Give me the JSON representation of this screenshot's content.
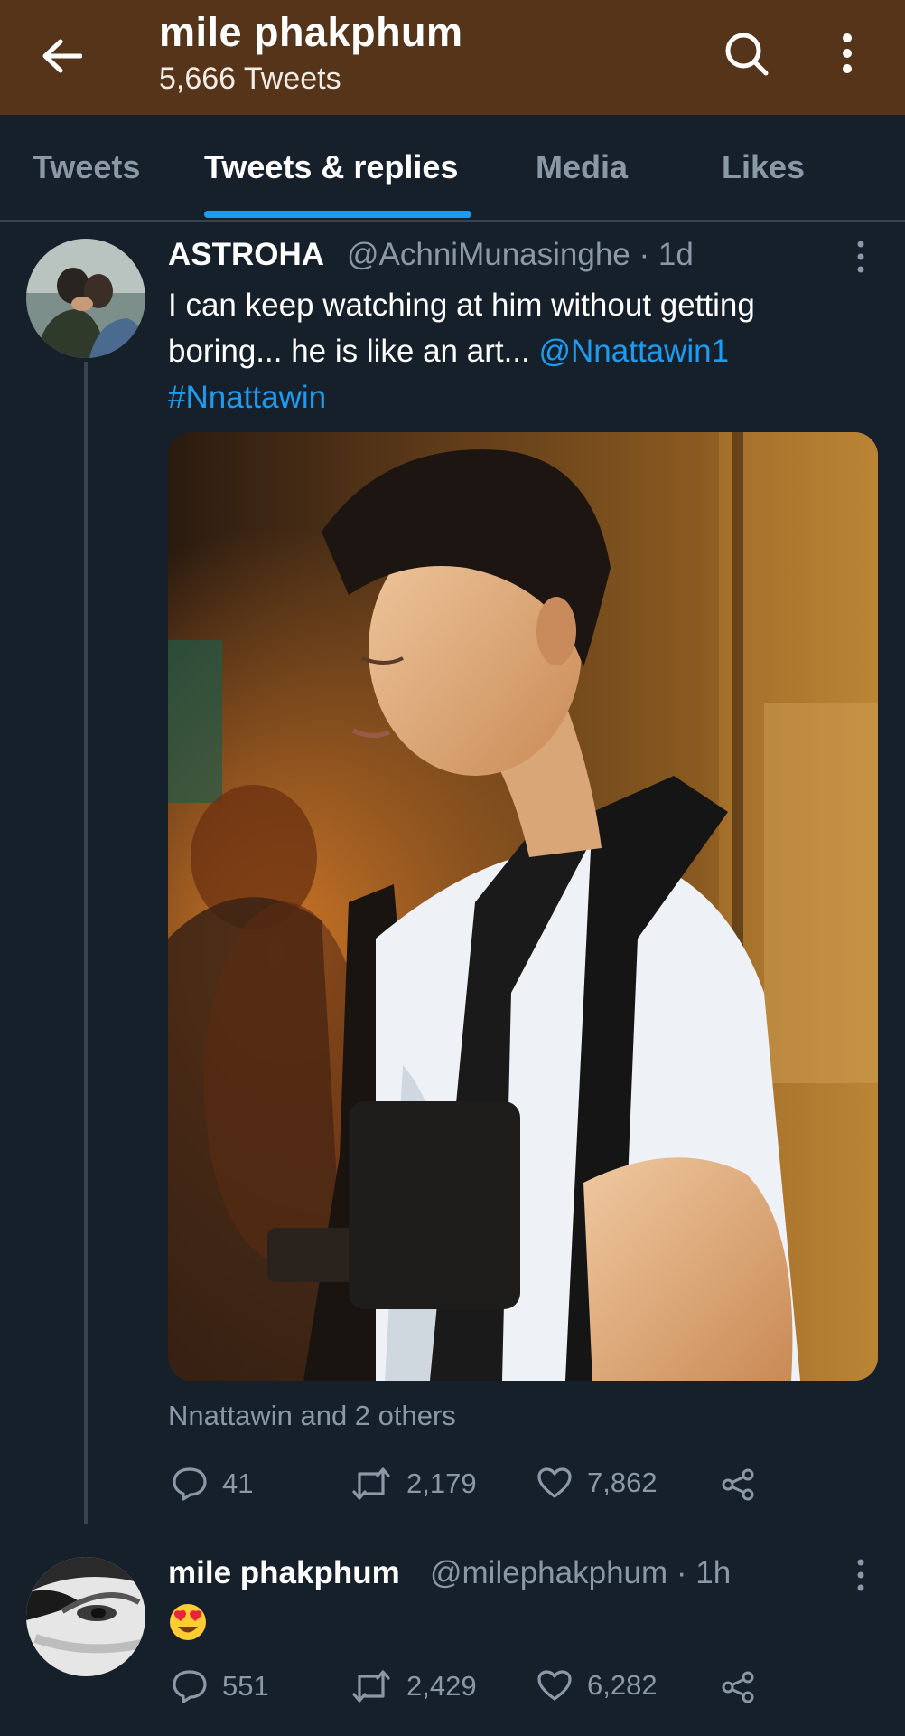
{
  "header": {
    "title": "mile phakphum",
    "subtitle": "5,666 Tweets",
    "back_icon": "arrow-left-icon",
    "search_icon": "search-icon",
    "more_icon": "more-vertical-icon",
    "background": "#55341a"
  },
  "tabs": [
    {
      "label": "Tweets",
      "active": false
    },
    {
      "label": "Tweets & replies",
      "active": true
    },
    {
      "label": "Media",
      "active": false
    },
    {
      "label": "Likes",
      "active": false
    }
  ],
  "colors": {
    "background": "#15202b",
    "accent": "#1d9bf0",
    "muted": "#8b98a5",
    "divider": "#38444d"
  },
  "tweets": [
    {
      "name": "ASTROHA",
      "handle_time": "@AchniMunasinghe · 1d",
      "text_lines": [
        "I can keep watching at him without getting",
        "boring... he is like an art... "
      ],
      "mention": "@Nnattawin1",
      "hashtag": "#Nnattawin",
      "media_alt": "photo",
      "tagged": "Nnattawin and 2 others",
      "replies": "41",
      "retweets": "2,179",
      "likes": "7,862"
    },
    {
      "name": "mile phakphum",
      "handle_time": "@milephakphum · 1h",
      "text": "😍",
      "replies": "551",
      "retweets": "2,429",
      "likes": "6,282"
    }
  ]
}
